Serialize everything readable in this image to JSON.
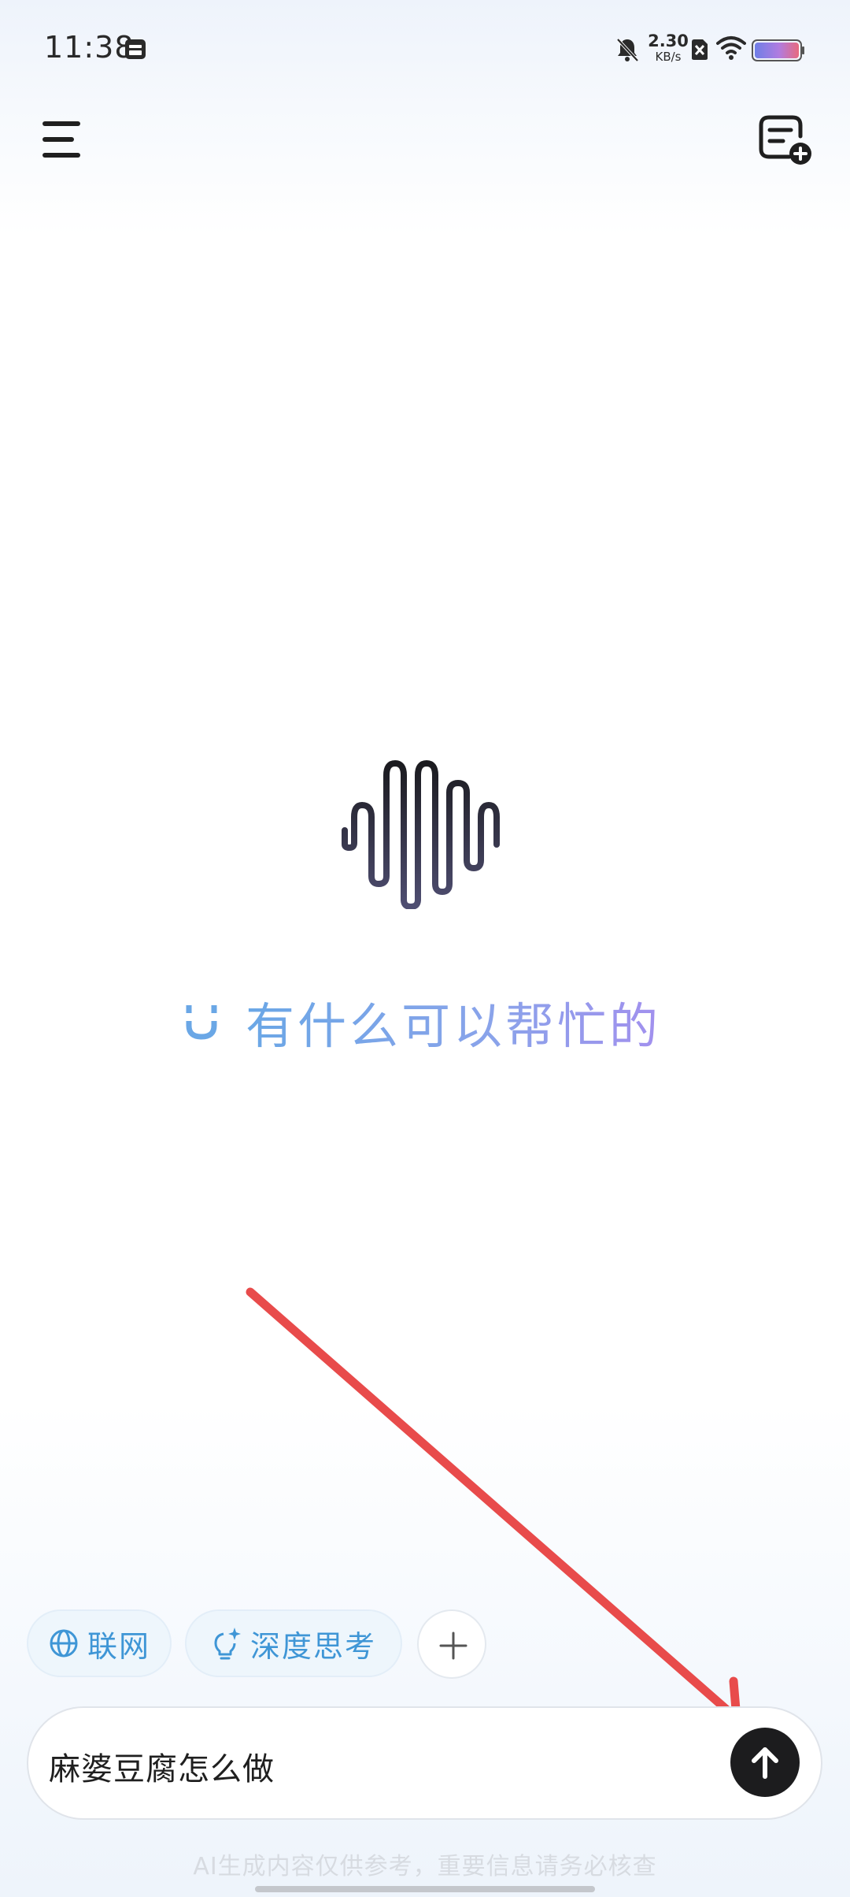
{
  "status_bar": {
    "time": "11:38",
    "net_speed_value": "2.30",
    "net_speed_unit": "KB/s",
    "icons": [
      "calendar-icon",
      "bell-off-icon",
      "sim-disabled-icon",
      "wifi-icon",
      "battery-icon"
    ]
  },
  "header": {
    "menu_icon": "hamburger-menu-icon",
    "new_chat_icon": "new-chat-icon"
  },
  "center": {
    "greeting": "有什么可以帮忙的"
  },
  "chips": {
    "web_label": "联网",
    "think_label": "深度思考"
  },
  "input": {
    "value": "麻婆豆腐怎么做"
  },
  "footer": {
    "disclaimer": "AI生成内容仅供参考，重要信息请务必核查"
  },
  "colors": {
    "accent_blue": "#3f96d6",
    "greeting_gradient_start": "#6aa7e6",
    "greeting_gradient_end": "#a290ee",
    "send_button": "#1c1c1e",
    "annotation_arrow": "#e84b4b"
  }
}
